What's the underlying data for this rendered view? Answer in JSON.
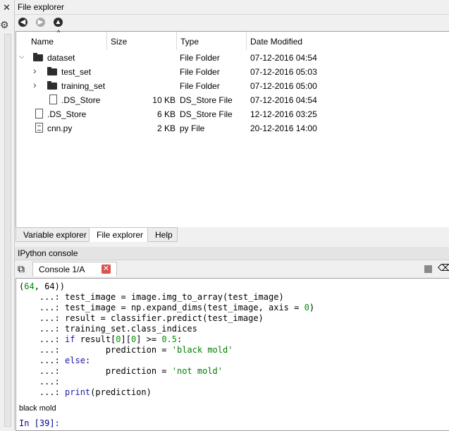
{
  "file_explorer": {
    "title": "File explorer",
    "columns": [
      "Name",
      "Size",
      "Type",
      "Date Modified"
    ],
    "rows": [
      {
        "name": "dataset",
        "size": "",
        "type": "File Folder",
        "date": "07-12-2016 04:54",
        "icon": "folder-icon",
        "indent": 0,
        "expander": "open"
      },
      {
        "name": "test_set",
        "size": "",
        "type": "File Folder",
        "date": "07-12-2016 05:03",
        "icon": "folder-icon",
        "indent": 1,
        "expander": "closed"
      },
      {
        "name": "training_set",
        "size": "",
        "type": "File Folder",
        "date": "07-12-2016 05:00",
        "icon": "folder-icon",
        "indent": 1,
        "expander": "closed"
      },
      {
        "name": ".DS_Store",
        "size": "10 KB",
        "type": "DS_Store File",
        "date": "07-12-2016 04:54",
        "icon": "file-icon",
        "indent": 1,
        "expander": "none"
      },
      {
        "name": ".DS_Store",
        "size": "6 KB",
        "type": "DS_Store File",
        "date": "12-12-2016 03:25",
        "icon": "file-icon",
        "indent": 0,
        "expander": "none"
      },
      {
        "name": "cnn.py",
        "size": "2 KB",
        "type": "py File",
        "date": "20-12-2016 14:00",
        "icon": "py-file-icon",
        "indent": 0,
        "expander": "none"
      }
    ]
  },
  "tabs": [
    "Variable explorer",
    "File explorer",
    "Help"
  ],
  "active_tab": "File explorer",
  "ipython": {
    "title": "IPython console",
    "console_tab": "Console 1/A",
    "lines": [
      "(64, 64))",
      "    ...: test_image = image.img_to_array(test_image)",
      "    ...: test_image = np.expand_dims(test_image, axis = 0)",
      "    ...: result = classifier.predict(test_image)",
      "    ...: training_set.class_indices",
      "    ...: if result[0][0] >= 0.5:",
      "    ...:         prediction = 'black mold'",
      "    ...: else:",
      "    ...:         prediction = 'not mold'",
      "    ...: ",
      "    ...: print(prediction)"
    ],
    "output": "black mold",
    "prompt": "In [39]:"
  }
}
